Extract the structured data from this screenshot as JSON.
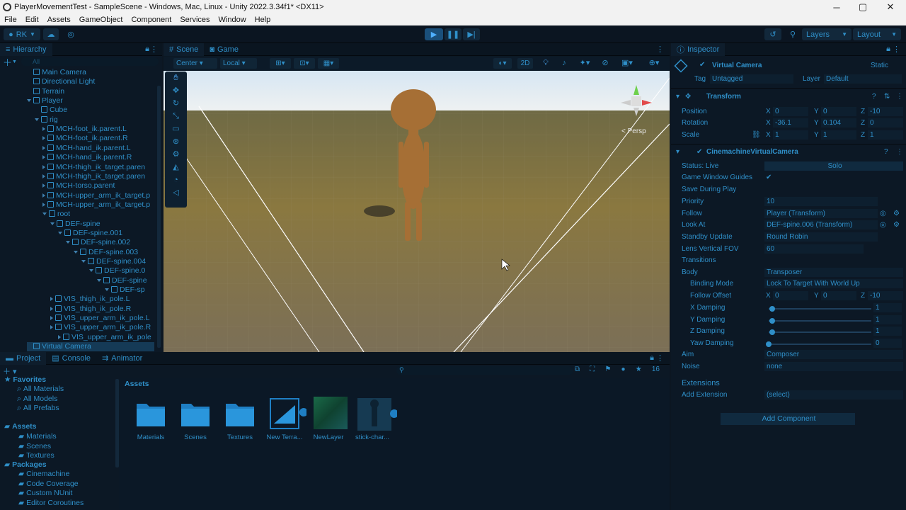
{
  "title": "PlayerMovementTest - SampleScene - Windows, Mac, Linux - Unity 2022.3.34f1* <DX11>",
  "window_controls": {
    "min": "─",
    "max": "▢",
    "close": "✕"
  },
  "menu": [
    "File",
    "Edit",
    "Assets",
    "GameObject",
    "Component",
    "Services",
    "Window",
    "Help"
  ],
  "toolbar": {
    "account": "RK",
    "layers": "Layers",
    "layout": "Layout"
  },
  "hierarchy": {
    "tab": "Hierarchy",
    "search": "All",
    "items": [
      {
        "label": "Main Camera",
        "indent": 0
      },
      {
        "label": "Directional Light",
        "indent": 0
      },
      {
        "label": "Terrain",
        "indent": 0
      },
      {
        "label": "Player",
        "indent": 0
      },
      {
        "label": "Cube",
        "indent": 1
      },
      {
        "label": "rig",
        "indent": 1
      },
      {
        "label": "MCH-foot_ik.parent.L",
        "indent": 2
      },
      {
        "label": "MCH-foot_ik.parent.R",
        "indent": 2
      },
      {
        "label": "MCH-hand_ik.parent.L",
        "indent": 2
      },
      {
        "label": "MCH-hand_ik.parent.R",
        "indent": 2
      },
      {
        "label": "MCH-thigh_ik_target.paren",
        "indent": 2
      },
      {
        "label": "MCH-thigh_ik_target.paren",
        "indent": 2
      },
      {
        "label": "MCH-torso.parent",
        "indent": 2
      },
      {
        "label": "MCH-upper_arm_ik_target.p",
        "indent": 2
      },
      {
        "label": "MCH-upper_arm_ik_target.p",
        "indent": 2
      },
      {
        "label": "root",
        "indent": 2
      },
      {
        "label": "DEF-spine",
        "indent": 3
      },
      {
        "label": "DEF-spine.001",
        "indent": 4
      },
      {
        "label": "DEF-spine.002",
        "indent": 5
      },
      {
        "label": "DEF-spine.003",
        "indent": 6
      },
      {
        "label": "DEF-spine.004",
        "indent": 7
      },
      {
        "label": "DEF-spine.0",
        "indent": 8
      },
      {
        "label": "DEF-spine",
        "indent": 9
      },
      {
        "label": "DEF-sp",
        "indent": 10
      },
      {
        "label": "VIS_thigh_ik_pole.L",
        "indent": 3
      },
      {
        "label": "VIS_thigh_ik_pole.R",
        "indent": 3
      },
      {
        "label": "VIS_upper_arm_ik_pole.L",
        "indent": 3
      },
      {
        "label": "VIS_upper_arm_ik_pole.R",
        "indent": 3
      },
      {
        "label": "VIS_upper_arm_ik_pole",
        "indent": 4
      },
      {
        "label": "Virtual Camera",
        "indent": 0
      }
    ]
  },
  "scene": {
    "tabs": [
      "Scene",
      "Game"
    ],
    "pivot": "Center",
    "space": "Local",
    "mode2d": "2D",
    "persp": "< Persp"
  },
  "inspector": {
    "tab": "Inspector",
    "object_name": "Virtual Camera",
    "static": "Static",
    "tag_label": "Tag",
    "tag": "Untagged",
    "layer_label": "Layer",
    "layer": "Default",
    "transform": {
      "title": "Transform",
      "position": {
        "label": "Position",
        "x": "0",
        "y": "0",
        "z": "-10"
      },
      "rotation": {
        "label": "Rotation",
        "x": "-36.1",
        "y": "0.104",
        "z": "0"
      },
      "scale": {
        "label": "Scale",
        "x": "1",
        "y": "1",
        "z": "1"
      }
    },
    "cm": {
      "title": "CinemachineVirtualCamera",
      "status_label": "Status: Live",
      "solo": "Solo",
      "game_guides": "Game Window Guides",
      "save_play": "Save During Play",
      "priority_label": "Priority",
      "priority": "10",
      "follow_label": "Follow",
      "follow": "Player (Transform)",
      "lookat_label": "Look At",
      "lookat": "DEF-spine.006 (Transform)",
      "standby_label": "Standby Update",
      "standby": "Round Robin",
      "fov_label": "Lens Vertical FOV",
      "fov": "60",
      "transitions": "Transitions",
      "body_label": "Body",
      "body": "Transposer",
      "binding_label": "Binding Mode",
      "binding": "Lock To Target With World Up",
      "follow_offset_label": "Follow Offset",
      "fo_x": "0",
      "fo_y": "0",
      "fo_z": "-10",
      "xdamp_label": "X Damping",
      "xdamp": "1",
      "ydamp_label": "Y Damping",
      "ydamp": "1",
      "zdamp_label": "Z Damping",
      "zdamp": "1",
      "yawdamp_label": "Yaw Damping",
      "yawdamp": "0",
      "aim_label": "Aim",
      "aim": "Composer",
      "noise_label": "Noise",
      "noise": "none",
      "extensions": "Extensions",
      "add_ext_label": "Add Extension",
      "add_ext": "(select)",
      "add_component": "Add Component"
    }
  },
  "project": {
    "tabs": [
      "Project",
      "Console",
      "Animator"
    ],
    "count": "16",
    "breadcrumb": "Assets",
    "favorites": {
      "title": "Favorites",
      "items": [
        "All Materials",
        "All Models",
        "All Prefabs"
      ]
    },
    "assets": {
      "title": "Assets",
      "items": [
        "Materials",
        "Scenes",
        "Textures"
      ]
    },
    "packages": {
      "title": "Packages",
      "items": [
        "Cinemachine",
        "Code Coverage",
        "Custom NUnit",
        "Editor Coroutines"
      ]
    },
    "files": [
      "Materials",
      "Scenes",
      "Textures",
      "New Terra...",
      "NewLayer",
      "stick-char..."
    ]
  },
  "colors": {
    "accent": "#2f8fc8",
    "panel": "#0c1825",
    "ground": "#7a6a3a",
    "sky": "#c9d8e6"
  }
}
